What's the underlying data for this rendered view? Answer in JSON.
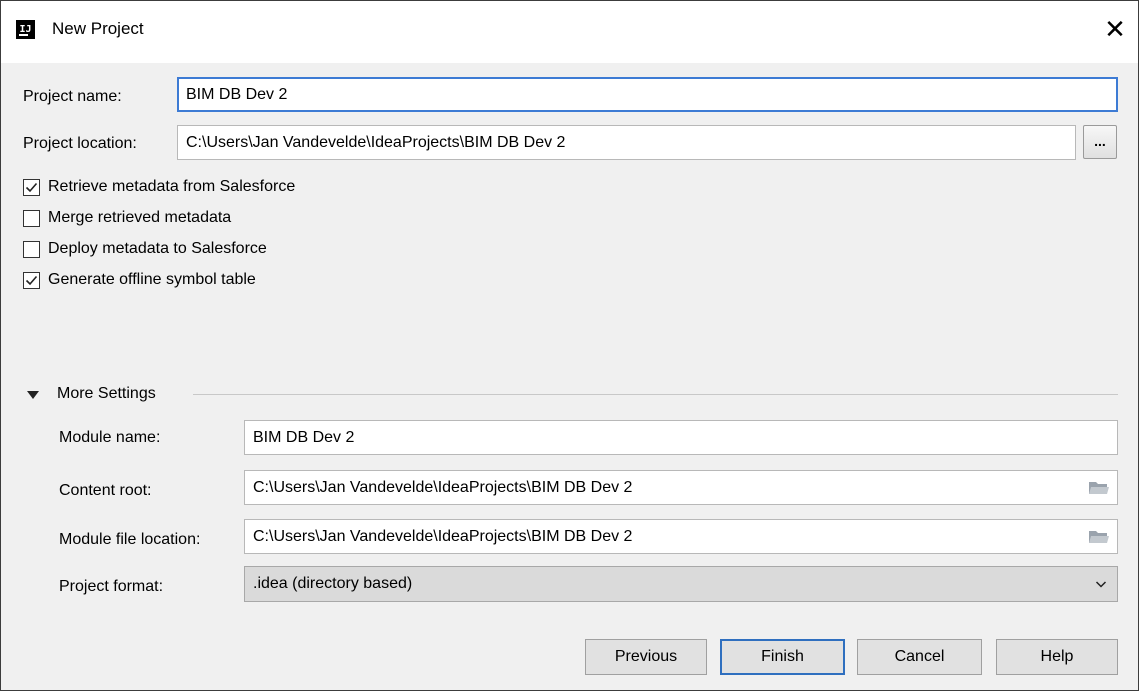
{
  "window": {
    "title": "New Project",
    "app_icon_glyph": "IJ",
    "close_glyph": "✕"
  },
  "project": {
    "name_label": "Project name:",
    "name_value": "BIM DB Dev 2",
    "location_label": "Project location:",
    "location_value": "C:\\Users\\Jan Vandevelde\\IdeaProjects\\BIM DB Dev 2",
    "browse_label": "..."
  },
  "options": [
    {
      "label": "Retrieve metadata from Salesforce",
      "checked": true
    },
    {
      "label": "Merge retrieved metadata",
      "checked": false
    },
    {
      "label": "Deploy metadata to Salesforce",
      "checked": false
    },
    {
      "label": "Generate offline symbol table",
      "checked": true
    }
  ],
  "more_settings": {
    "label": "More Settings",
    "expanded": true,
    "module_name_label": "Module name:",
    "module_name_value": "BIM DB Dev 2",
    "content_root_label": "Content root:",
    "content_root_value": "C:\\Users\\Jan Vandevelde\\IdeaProjects\\BIM DB Dev 2",
    "module_file_location_label": "Module file location:",
    "module_file_location_value": "C:\\Users\\Jan Vandevelde\\IdeaProjects\\BIM DB Dev 2",
    "project_format_label": "Project format:",
    "project_format_value": ".idea (directory based)"
  },
  "buttons": {
    "previous": "Previous",
    "finish": "Finish",
    "cancel": "Cancel",
    "help": "Help"
  },
  "icons": {
    "app": "intellij-icon",
    "close": "close-icon",
    "folder": "folder-icon",
    "dropdown": "chevron-down-icon",
    "expand": "triangle-down-icon",
    "check": "checkmark-icon"
  },
  "colors": {
    "focus_border": "#3d7bd4",
    "default_button_border": "#2f6fbf",
    "dialog_background": "#f0f0f0"
  }
}
